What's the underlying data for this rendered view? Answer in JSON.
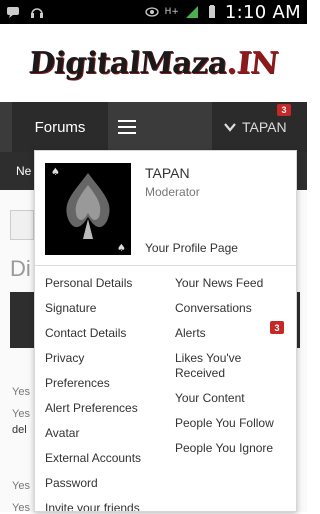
{
  "statusbar": {
    "time": "1:10 AM",
    "icons": [
      "chat-icon",
      "headphones-icon",
      "eye-icon",
      "hspa-icon",
      "wifi-icon",
      "signal-icon",
      "battery-icon"
    ],
    "network_label": "H+"
  },
  "site": {
    "logo_text_main": "DigitalMaza",
    "logo_text_suffix": ".IN"
  },
  "nav": {
    "forums_label": "Forums",
    "user_label": "TAPAN",
    "alerts_badge": "3",
    "subnav_text": "Ne"
  },
  "background": {
    "title_fragment": "Di",
    "line1": "Yes",
    "line2": "Yes",
    "line3": "del",
    "line4": "Yes",
    "line5": "Yes"
  },
  "dropdown": {
    "username": "TAPAN",
    "role": "Moderator",
    "profile_link": "Your Profile Page",
    "left_items": [
      "Personal Details",
      "Signature",
      "Contact Details",
      "Privacy",
      "Preferences",
      "Alert Preferences",
      "Avatar",
      "External Accounts",
      "Password",
      "Invite your friends"
    ],
    "right_items": [
      "Your News Feed",
      "Conversations",
      "Alerts",
      "Likes You've Received",
      "Your Content",
      "People You Follow",
      "People You Ignore"
    ],
    "alerts_badge": "3"
  },
  "colors": {
    "nav_bg": "#3b3b3b",
    "badge": "#c62828"
  }
}
